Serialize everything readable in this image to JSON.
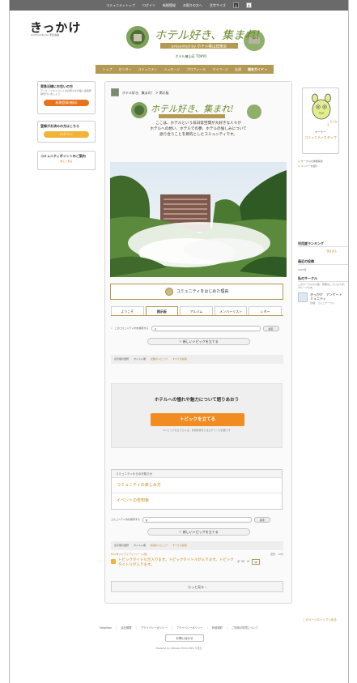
{
  "topbar": {
    "links": [
      "コミュニティトップ",
      "ログイン",
      "新規登録",
      "お困りの方へ"
    ],
    "font_size_label": "文字サイズ",
    "font_small": "A",
    "font_large": "A"
  },
  "logo": {
    "text": "きっかけ",
    "sub": "Community by 東急電鉄"
  },
  "global_nav": {
    "items": [
      "トップ",
      "センター",
      "コミュニティ",
      "メッセージ",
      "プロフィール",
      "マイページ",
      "友達"
    ],
    "guide": "総合ガイド ▾"
  },
  "left": {
    "box1": {
      "title": "東急沿線にお住いの方",
      "desc": "アンケートやイベントのお知らせが届く会員登録を行いましょう",
      "button": "新規登録(無料)"
    },
    "box2": {
      "title": "登録がお済みの方はこちら",
      "button": "ログイン"
    },
    "box3": {
      "title": "コミュニティポイントのご案内",
      "link": "詳しく見る"
    }
  },
  "breadcrumb": "ホテル好き、集まれ！ > 掲示板",
  "intro": "ここは、ホテルという非日常空間が大好きな人々が\nホテルへの想い、ホテルでの夢、ホテルの愉しみについて\n語り合うことを目的としたコミュニティです。",
  "reason_button": "コミュニティをはじめた理由",
  "tabs": [
    "ようこそ",
    "掲示板",
    "アルバム",
    "メンバーリスト",
    "レター"
  ],
  "search": {
    "label": "このコミュニティ内を検索する",
    "placeholder": "",
    "button": "検索"
  },
  "new_topic_button": "新しいトピックを立てる",
  "sorts": [
    "表示順の選択",
    "タイトル順",
    "記載のトピック",
    "すべての投稿"
  ],
  "empty": {
    "heading": "ホテルへの憧れや魅力について語りあおう",
    "button": "トピックを立てる",
    "note": "※トピックを立てるには、新規登録またはログインが必要です"
  },
  "notice": {
    "header": "コミュニティからのお知らせ",
    "items": [
      "コミュニティの楽しみ方",
      "イベントの告知板"
    ]
  },
  "search2": {
    "label": "コミュニティ内を検索する",
    "placeholder": "",
    "button": "検索"
  },
  "new_topic_button2": "新しいトピックを立てる",
  "sorts2": [
    "表示順の選択",
    "タイトル順",
    "新着のトピック",
    "すべての投稿"
  ],
  "topic": {
    "meta_left": "Pick ▼ ハイアイアイリゾート(仮)",
    "meta_right": "更新：10件",
    "title": "トピックタイトルが入ります。トピックタイトルが入ります。トピックタイトルが入ります。",
    "stats": "ポ 30",
    "count": "10"
  },
  "more": "もっと見る ›",
  "right": {
    "favorite": "♡ 気になる",
    "owner_label": "オーナー",
    "community_name": "コミュニティスタッフ",
    "links": [
      "サークルの詳細情報",
      "メンバーを紹介"
    ],
    "ranking_title": "利用度ランキング",
    "ranking_link": "一覧を見る",
    "recent_title": "最近の投稿",
    "recent_value": "2022年",
    "circle_title": "私のサークル",
    "circle_note": "このサークルの人数、所属をしている人が、グループです。",
    "community": {
      "name": "きっかけ　アンケート\nミュニティ",
      "sub": "管理：コミュサークル"
    }
  },
  "page_top": "このページのトップへ戻る",
  "footer": {
    "links": [
      "Neighbor",
      "会社概要",
      "プライバシーポリシー",
      "プライバシーポリシー",
      "利用規約",
      "ご利用の環境について"
    ],
    "inquiry": "お問い合わせ",
    "copyright": "Powered by kikkake 2016-2020 ©東急"
  }
}
